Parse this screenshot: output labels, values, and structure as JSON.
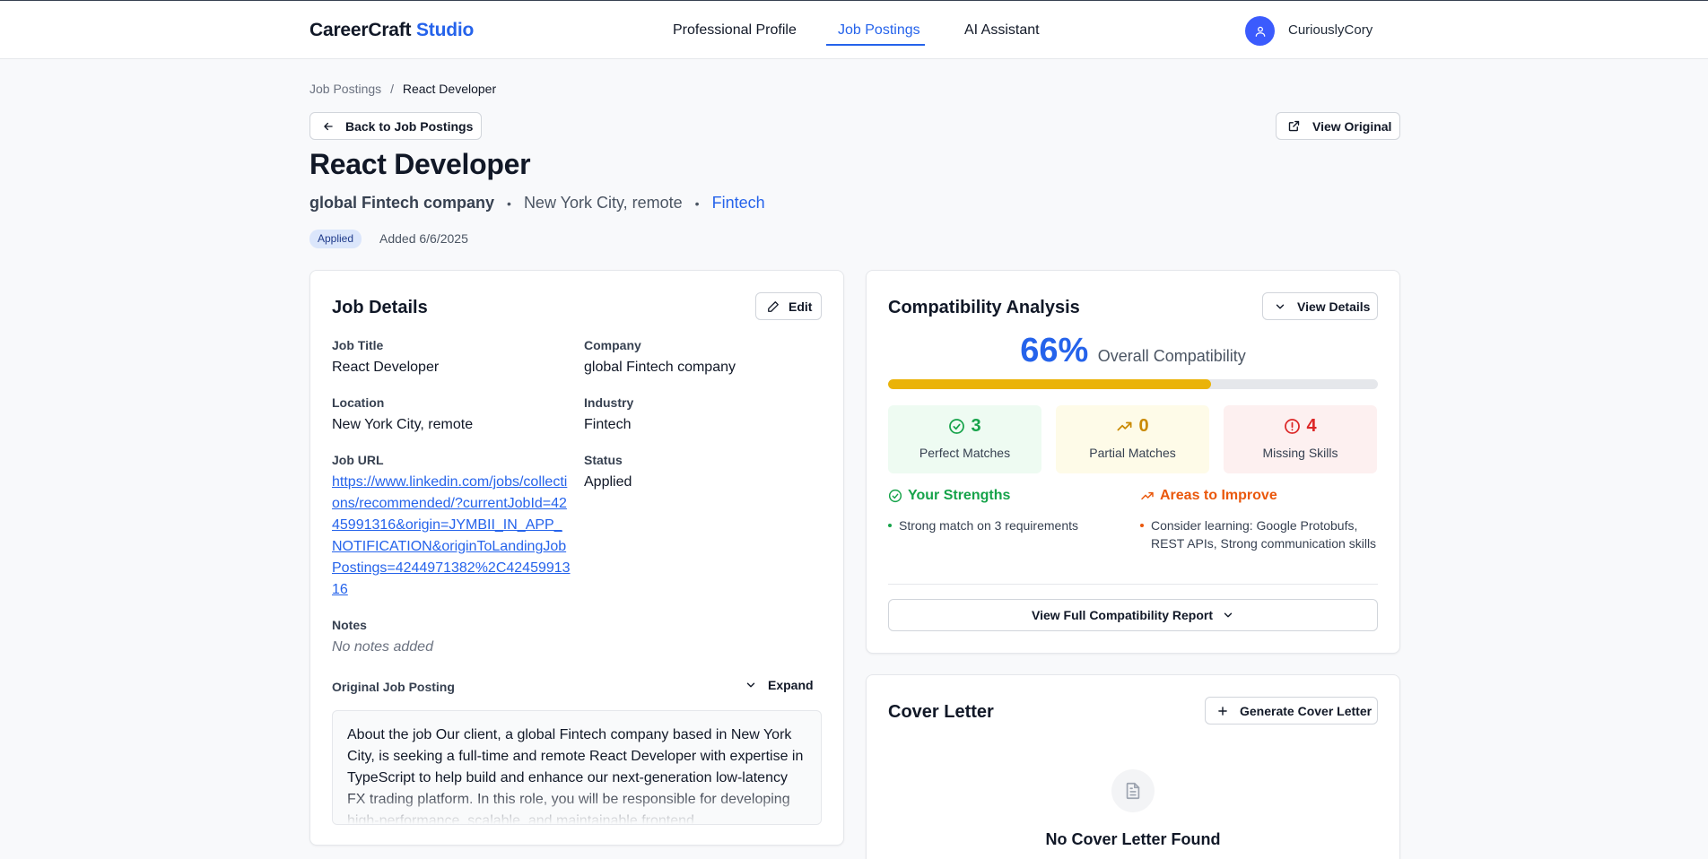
{
  "header": {
    "brand_main": "CareerCraft",
    "brand_accent": "Studio",
    "nav": [
      "Professional Profile",
      "Job Postings",
      "AI Assistant"
    ],
    "active_nav": "Job Postings",
    "username": "CuriouslyCory"
  },
  "breadcrumb": {
    "parent": "Job Postings",
    "separator": "/",
    "current": "React Developer"
  },
  "actions": {
    "back": "Back to Job Postings",
    "view_original": "View Original"
  },
  "job": {
    "title": "React Developer",
    "company": "global Fintech company",
    "location": "New York City, remote",
    "industry": "Fintech",
    "status_badge": "Applied",
    "added": "Added 6/6/2025",
    "dot": "•"
  },
  "details": {
    "heading": "Job Details",
    "edit": "Edit",
    "labels": {
      "title": "Job Title",
      "company": "Company",
      "location": "Location",
      "industry": "Industry",
      "url": "Job URL",
      "status": "Status",
      "notes": "Notes"
    },
    "values": {
      "title": "React Developer",
      "company": "global Fintech company",
      "location": "New York City, remote",
      "industry": "Fintech",
      "url": "https://www.linkedin.com/jobs/collections/recommended/?currentJobId=4245991316&origin=JYMBII_IN_APP_NOTIFICATION&originToLandingJobPostings=4244971382%2C4245991316",
      "status": "Applied",
      "notes": "No notes added"
    },
    "original_posting_label": "Original Job Posting",
    "expand": "Expand",
    "posting_text": "About the job Our client, a global Fintech company based in New York City, is seeking a full-time and remote React Developer with expertise in TypeScript to help build and enhance our next-generation low-latency FX trading platform. In this role, you will be responsible for developing high-performance, scalable, and maintainable frontend"
  },
  "compatibility": {
    "heading": "Compatibility Analysis",
    "view_details": "View Details",
    "score": "66%",
    "score_fraction": 0.66,
    "score_label": "Overall Compatibility",
    "stats": {
      "perfect": {
        "value": "3",
        "label": "Perfect Matches"
      },
      "partial": {
        "value": "0",
        "label": "Partial Matches"
      },
      "missing": {
        "value": "4",
        "label": "Missing Skills"
      }
    },
    "strengths_heading": "Your Strengths",
    "strengths": [
      "Strong match on 3 requirements"
    ],
    "improve_heading": "Areas to Improve",
    "improve": [
      "Consider learning: Google Protobufs, REST APIs, Strong communication skills"
    ],
    "full_report": "View Full Compatibility Report"
  },
  "cover_letter": {
    "heading": "Cover Letter",
    "generate": "Generate Cover Letter",
    "empty_title": "No Cover Letter Found"
  },
  "colors": {
    "accent": "#2563eb",
    "progress": "#eab308",
    "perfect_bg": "#eefbf2",
    "partial_bg": "#fefbe8",
    "missing_bg": "#fdf0f0"
  },
  "icons": [
    "user-icon",
    "arrow-left-icon",
    "external-link-icon",
    "pencil-icon",
    "chevron-down-icon",
    "check-circle-icon",
    "trending-up-icon",
    "alert-circle-icon",
    "plus-icon",
    "document-icon"
  ]
}
